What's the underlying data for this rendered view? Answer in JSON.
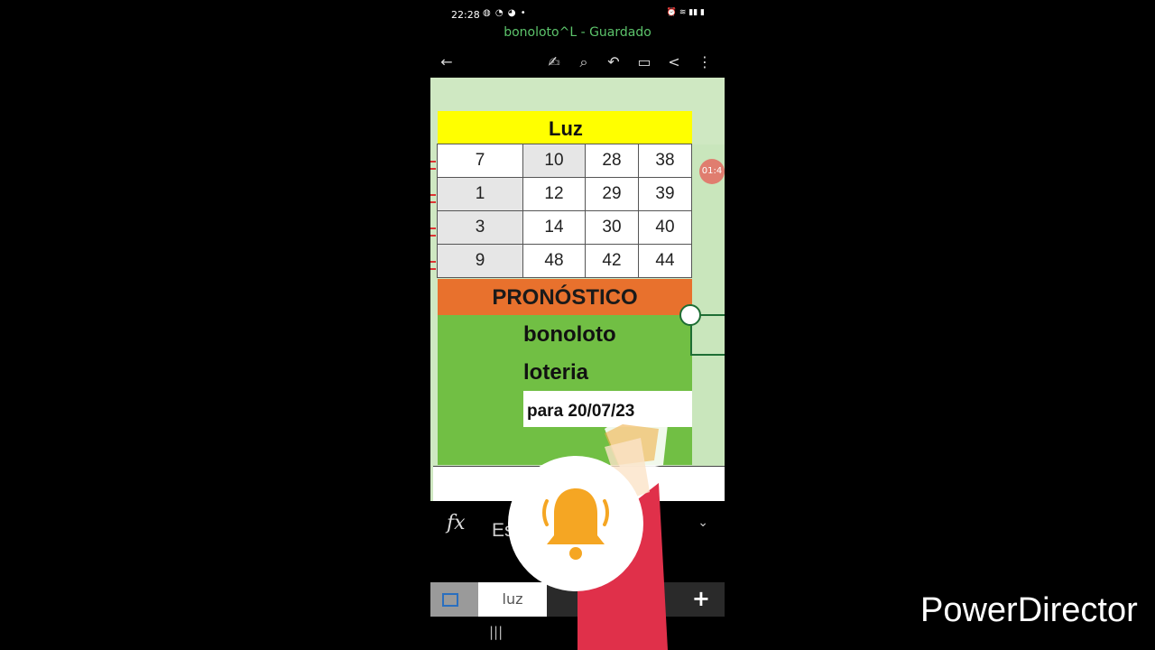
{
  "status_bar": {
    "time": "22:28",
    "left_icons": "◍ ◔ ◕ •",
    "right_icons": "⏰ ≋ ▮▮ ▮"
  },
  "document": {
    "title": "bonoloto^L - Guardado"
  },
  "toolbar": {
    "back_icon": "←",
    "draw_icon": "✍",
    "search_icon": "⌕",
    "undo_icon": "↶",
    "comment_icon": "▭",
    "share_icon": "<",
    "more_icon": "⋮"
  },
  "sheet": {
    "header": "Luz",
    "rows": [
      [
        "7",
        "10",
        "28",
        "38"
      ],
      [
        "1",
        "12",
        "29",
        "39"
      ],
      [
        "3",
        "14",
        "30",
        "40"
      ],
      [
        "9",
        "48",
        "42",
        "44"
      ]
    ],
    "banner": "PRONÓSTICO",
    "line1": "bonoloto",
    "line2": "loteria",
    "date_text": "para 20/07/23"
  },
  "formula_bar": {
    "fx": "fx",
    "text": "Es                  to o la",
    "chevron": "⌄"
  },
  "tabs": {
    "active": "luz",
    "add": "+"
  },
  "nav": {
    "recent": "|||"
  },
  "watermark": "PowerDirector",
  "colors": {
    "header_yellow": "#ffff00",
    "banner_orange": "#e8712d",
    "body_green": "#71bf44",
    "title_green": "#5cc36b",
    "bell_orange": "#f5a623"
  }
}
